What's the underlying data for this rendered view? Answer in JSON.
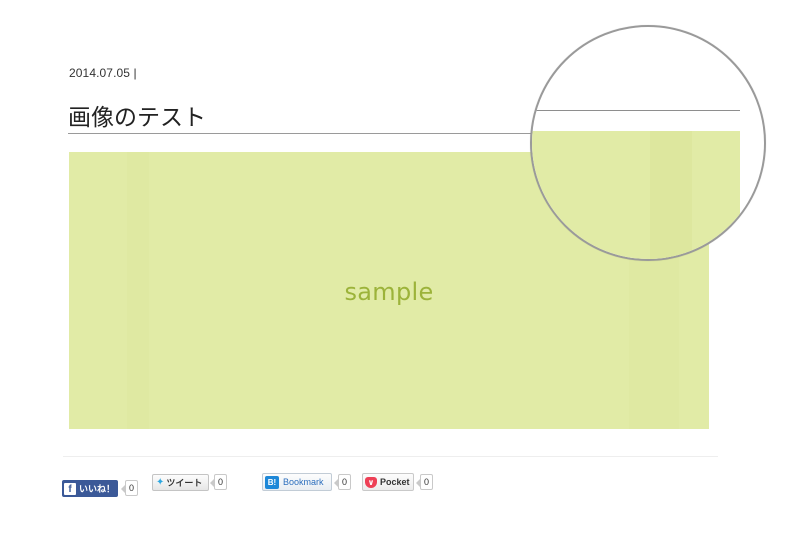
{
  "post": {
    "date": "2014.07.05 |",
    "title": "画像のテスト",
    "image_text": "sample"
  },
  "share": {
    "facebook": {
      "label": "いいね！",
      "count": "0",
      "icon": "facebook-icon"
    },
    "twitter": {
      "label": "ツイート",
      "count": "0",
      "icon": "twitter-bird-icon"
    },
    "hatena": {
      "label": "Bookmark",
      "count": "0",
      "icon_text": "B!",
      "icon": "hatena-bookmark-icon"
    },
    "pocket": {
      "label": "Pocket",
      "count": "0",
      "icon": "pocket-icon"
    }
  },
  "colors": {
    "image_bg": "#e1eba6",
    "image_text": "#9cb33a",
    "facebook": "#3b5998",
    "twitter": "#2ea7e0",
    "hatena": "#1e88d8",
    "pocket": "#ee4056"
  }
}
